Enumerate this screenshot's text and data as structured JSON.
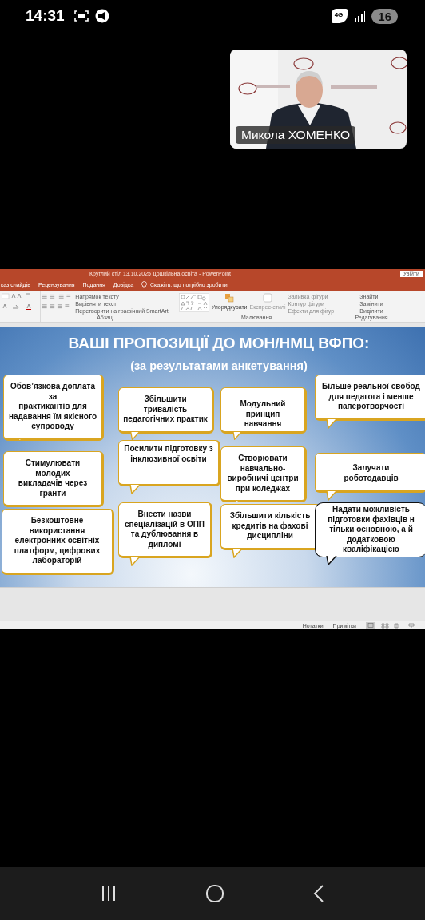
{
  "status_bar": {
    "time": "14:31",
    "network": "4G",
    "battery": "16"
  },
  "video_tile": {
    "kind": "picture",
    "name": "Микола ХОМЕНКО"
  },
  "powerpoint": {
    "title": "Круглий стіл 13.10.2025 Дошкільна освіта  -  PowerPoint",
    "sign_in": "Увійти",
    "tabs": [
      {
        "label": "каз слайдів",
        "selected": false
      },
      {
        "label": "Рецензування",
        "selected": false
      },
      {
        "label": "Подання",
        "selected": false
      },
      {
        "label": "Довідка",
        "selected": false
      }
    ],
    "tell_me": "Скажіть, що потрібно зробити",
    "ribbon_groups": [
      {
        "kind": "font"
      },
      {
        "kind": "paragraph",
        "label": "Абзац",
        "items": [
          "Напрямок тексту",
          "Вирівняти текст",
          "Перетворити на графічний SmartArt"
        ]
      },
      {
        "kind": "drawing",
        "label": "Малювання",
        "arrange": "Упорядкувати",
        "styles": "Експрес-стилі",
        "items": [
          "Заливка фігури",
          "Контур фігури",
          "Ефекти для фігур"
        ]
      },
      {
        "kind": "editing",
        "label": "Редагування",
        "items": [
          "Знайти",
          "Замінити",
          "Виділити"
        ]
      }
    ],
    "slide": {
      "title": "ВАШІ ПРОПОЗИЦІЇ ДО МОН/НМЦ ВФПО:",
      "subtitle": "(за результатами анкетування)",
      "bubbles": [
        {
          "kind": "gold",
          "text": "Обов’язкова доплата за\nпрактикантів для\nнадавання їм якісного\nсупроводу"
        },
        {
          "kind": "gold",
          "text": "Збільшити тривалість\nпедагогічних практик"
        },
        {
          "kind": "gold",
          "text": "Модульний\nпринцип\nнавчання"
        },
        {
          "kind": "gold",
          "text": "Більше реальної свобод\nдля педагога і менше\nпаперотворчості"
        },
        {
          "kind": "gold",
          "text": "Стимулювати молодих\nвикладачів через\nгранти"
        },
        {
          "kind": "gold",
          "text": "Посилити підготовку з\nінклюзивної освіти"
        },
        {
          "kind": "gold",
          "text": "Створювати\nнавчально-\nвиробничі центри\nпри коледжах"
        },
        {
          "kind": "gold",
          "text": "Залучати\nроботодавців"
        },
        {
          "kind": "gold",
          "text": "Безкоштовне використання\nелектронних освітніх\nплатформ, цифрових\nлабораторій"
        },
        {
          "kind": "gold",
          "text": "Внести назви\nспеціалізацій в ОПП\nта дублювання в\nдипломі"
        },
        {
          "kind": "gold",
          "text": "Збільшити кількість\nкредитів на фахові\nдисципліни"
        },
        {
          "kind": "dark",
          "text": "Надати можливість\nпідготовки фахівців н\nтільки основною, а й\nдодатковою\nкваліфікацією"
        }
      ]
    },
    "status_items": [
      "Нотатки",
      "Примітки"
    ]
  }
}
